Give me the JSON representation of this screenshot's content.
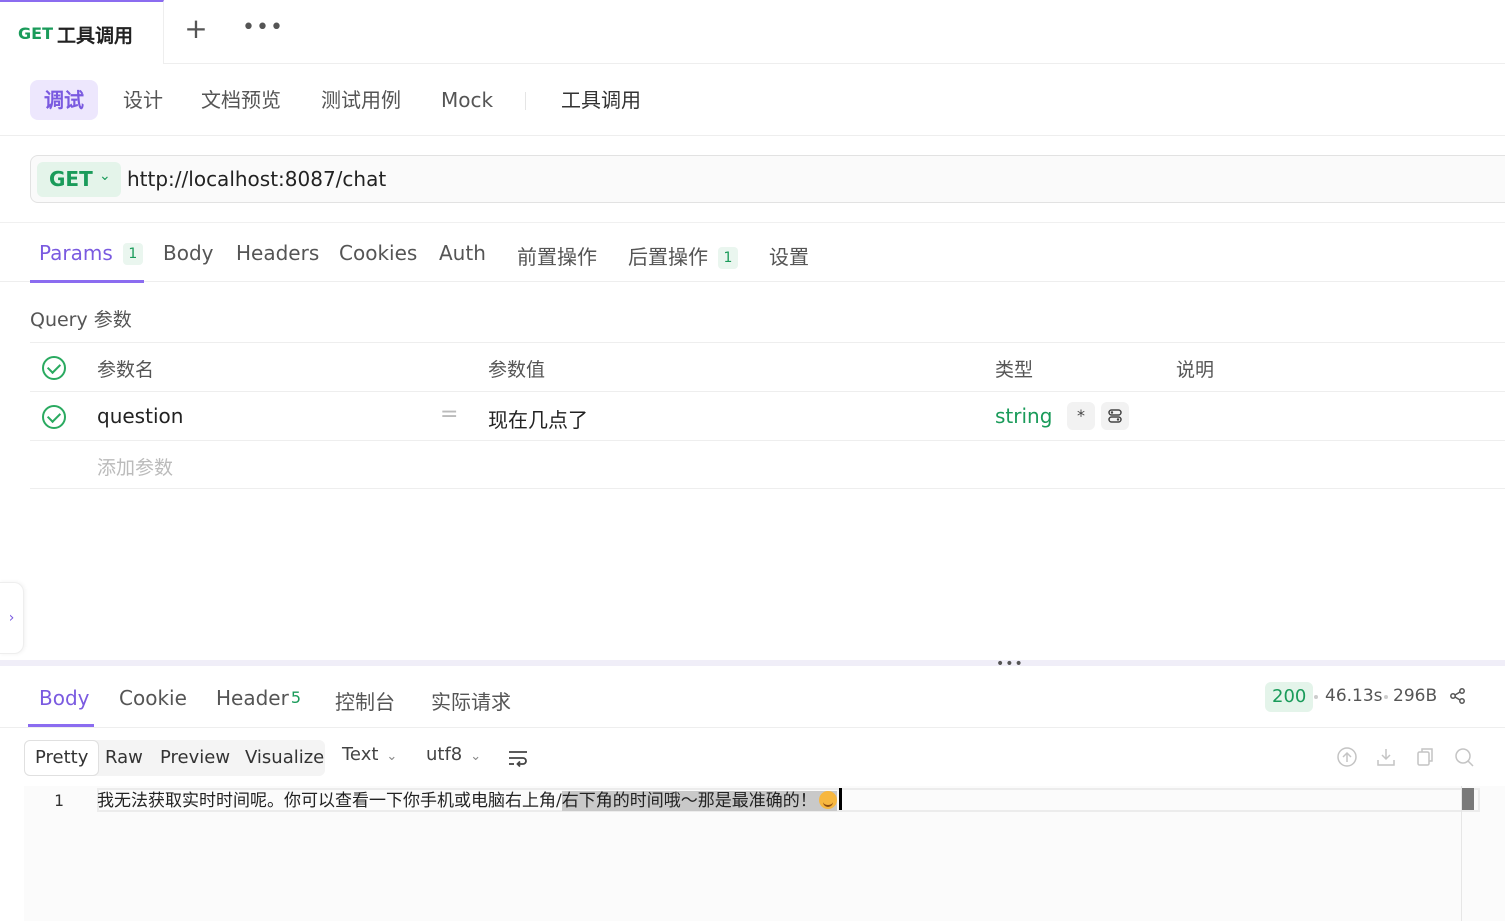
{
  "tabbar": {
    "method": "GET",
    "title": "工具调用",
    "add_label": "+",
    "more_label": "•••"
  },
  "modes": [
    {
      "label": "调试",
      "active": true
    },
    {
      "label": "设计"
    },
    {
      "label": "文档预览"
    },
    {
      "label": "测试用例"
    },
    {
      "label": "Mock"
    },
    {
      "label": "工具调用"
    }
  ],
  "request": {
    "method": "GET",
    "url": "http://localhost:8087/chat"
  },
  "request_tabs": {
    "params": "Params",
    "params_count": "1",
    "body": "Body",
    "headers": "Headers",
    "cookies": "Cookies",
    "auth": "Auth",
    "pre": "前置操作",
    "post": "后置操作",
    "post_count": "1",
    "settings": "设置"
  },
  "query": {
    "title": "Query 参数",
    "headers": {
      "name": "参数名",
      "value": "参数值",
      "type": "类型",
      "desc": "说明"
    },
    "rows": [
      {
        "name": "question",
        "eq": "=",
        "value": "现在几点了",
        "type": "string",
        "required_mark": "*"
      }
    ],
    "add_placeholder": "添加参数"
  },
  "response": {
    "tabs": {
      "body": "Body",
      "cookie": "Cookie",
      "header": "Header",
      "header_count": "5",
      "console": "控制台",
      "actual": "实际请求"
    },
    "status": "200",
    "time": "46.13s",
    "size": "296B",
    "format": {
      "pretty": "Pretty",
      "raw": "Raw",
      "preview": "Preview",
      "visualize": "Visualize",
      "type": "Text",
      "encoding": "utf8"
    },
    "line_number": "1",
    "line_text_plain": "我无法获取实时时间呢。你可以查看一下你手机或电脑右上角/",
    "line_text_selected": "右下角的时间哦～那是最准确的！"
  },
  "colors": {
    "accent": "#8b6cf0",
    "success": "#1a9b5a"
  }
}
